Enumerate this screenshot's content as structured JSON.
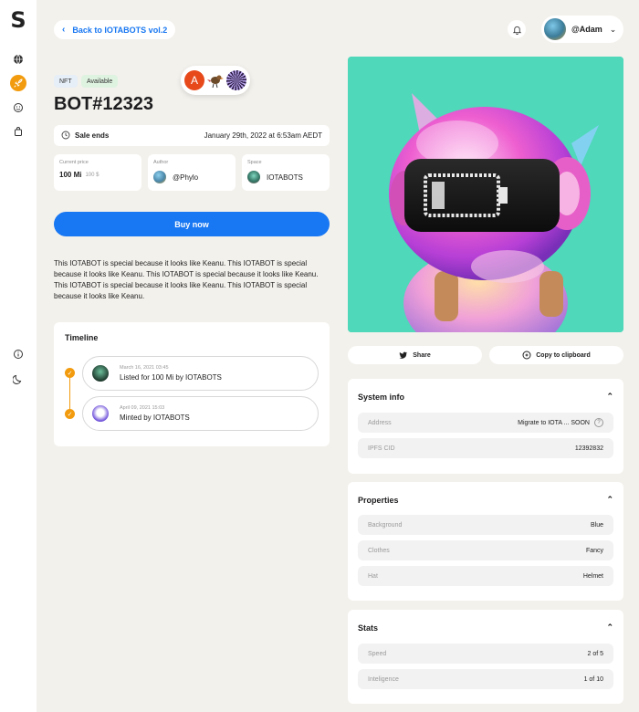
{
  "logo": "S",
  "nav": {
    "back_label": "Back to IOTABOTS vol.2"
  },
  "user": {
    "name": "@Adam"
  },
  "nft": {
    "badge_type": "NFT",
    "badge_status": "Available",
    "title": "BOT#12323",
    "chip_letter": "A",
    "sale_label": "Sale ends",
    "sale_value": "January 29th, 2022 at 6:53am AEDT",
    "price_label": "Current price",
    "price_value": "100 Mi",
    "price_secondary": "100 $",
    "author_label": "Author",
    "author_value": "@Phylo",
    "space_label": "Space",
    "space_value": "IOTABOTS",
    "buy_label": "Buy now",
    "description": "This IOTABOT is special because it looks like Keanu. This IOTABOT is special because it looks like Keanu. This IOTABOT is special because it looks like Keanu. This IOTABOT is special because it looks like Keanu. This IOTABOT is special because it looks like Keanu."
  },
  "timeline": {
    "title": "Timeline",
    "items": [
      {
        "date": "March 16, 2021   03:45",
        "text": "Listed for 100 Mi by IOTABOTS"
      },
      {
        "date": "April 09, 2021   15:03",
        "text": "Minted by IOTABOTS"
      }
    ]
  },
  "actions": {
    "share": "Share",
    "copy": "Copy to clipboard"
  },
  "system_info": {
    "title": "System info",
    "rows": [
      {
        "key": "Address",
        "value": "Migrate to IOTA ... SOON"
      },
      {
        "key": "IPFS CID",
        "value": "12392832"
      }
    ]
  },
  "properties": {
    "title": "Properties",
    "rows": [
      {
        "key": "Background",
        "value": "Blue"
      },
      {
        "key": "Clothes",
        "value": "Fancy"
      },
      {
        "key": "Hat",
        "value": "Helmet"
      }
    ]
  },
  "stats": {
    "title": "Stats",
    "rows": [
      {
        "key": "Speed",
        "value": "2 of 5"
      },
      {
        "key": "Inteligence",
        "value": "1 of 10"
      }
    ]
  },
  "colors": {
    "accent": "#1877f2",
    "orange": "#f29b0e",
    "art_bg": "#46d6b6"
  },
  "icons": [
    "globe-icon",
    "rocket-icon",
    "smile-icon",
    "bag-icon",
    "info-icon",
    "moon-icon",
    "bell-icon",
    "clock-icon",
    "twitter-icon",
    "copy-icon",
    "chevron-up-icon",
    "check-icon"
  ]
}
